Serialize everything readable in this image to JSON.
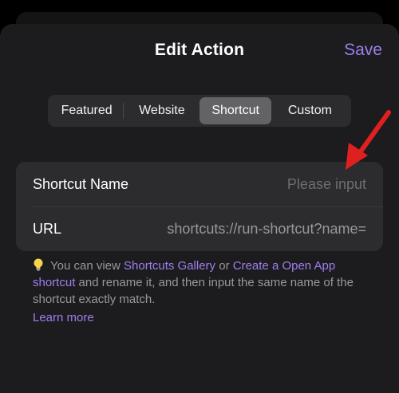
{
  "header": {
    "title": "Edit Action",
    "save_label": "Save"
  },
  "tabs": [
    {
      "label": "Featured",
      "selected": false
    },
    {
      "label": "Website",
      "selected": false
    },
    {
      "label": "Shortcut",
      "selected": true
    },
    {
      "label": "Custom",
      "selected": false
    }
  ],
  "form": {
    "shortcut_name": {
      "label": "Shortcut Name",
      "placeholder": "Please input",
      "value": ""
    },
    "url": {
      "label": "URL",
      "value": "shortcuts://run-shortcut?name="
    }
  },
  "info": {
    "text_1": "You can view",
    "link_gallery": "Shortcuts Gallery",
    "text_2": "or",
    "link_create": "Create a Open App shortcut",
    "text_3": "and rename it, and then input the same name of the shortcut exactly match.",
    "learn_more": "Learn more"
  },
  "colors": {
    "accent": "#a07df0",
    "arrow": "#e0201e",
    "background": "#1c1c1e",
    "card": "#2c2c2e"
  },
  "icons": {
    "info_icon": "lightbulb-icon",
    "annotation": "red-arrow-icon"
  }
}
